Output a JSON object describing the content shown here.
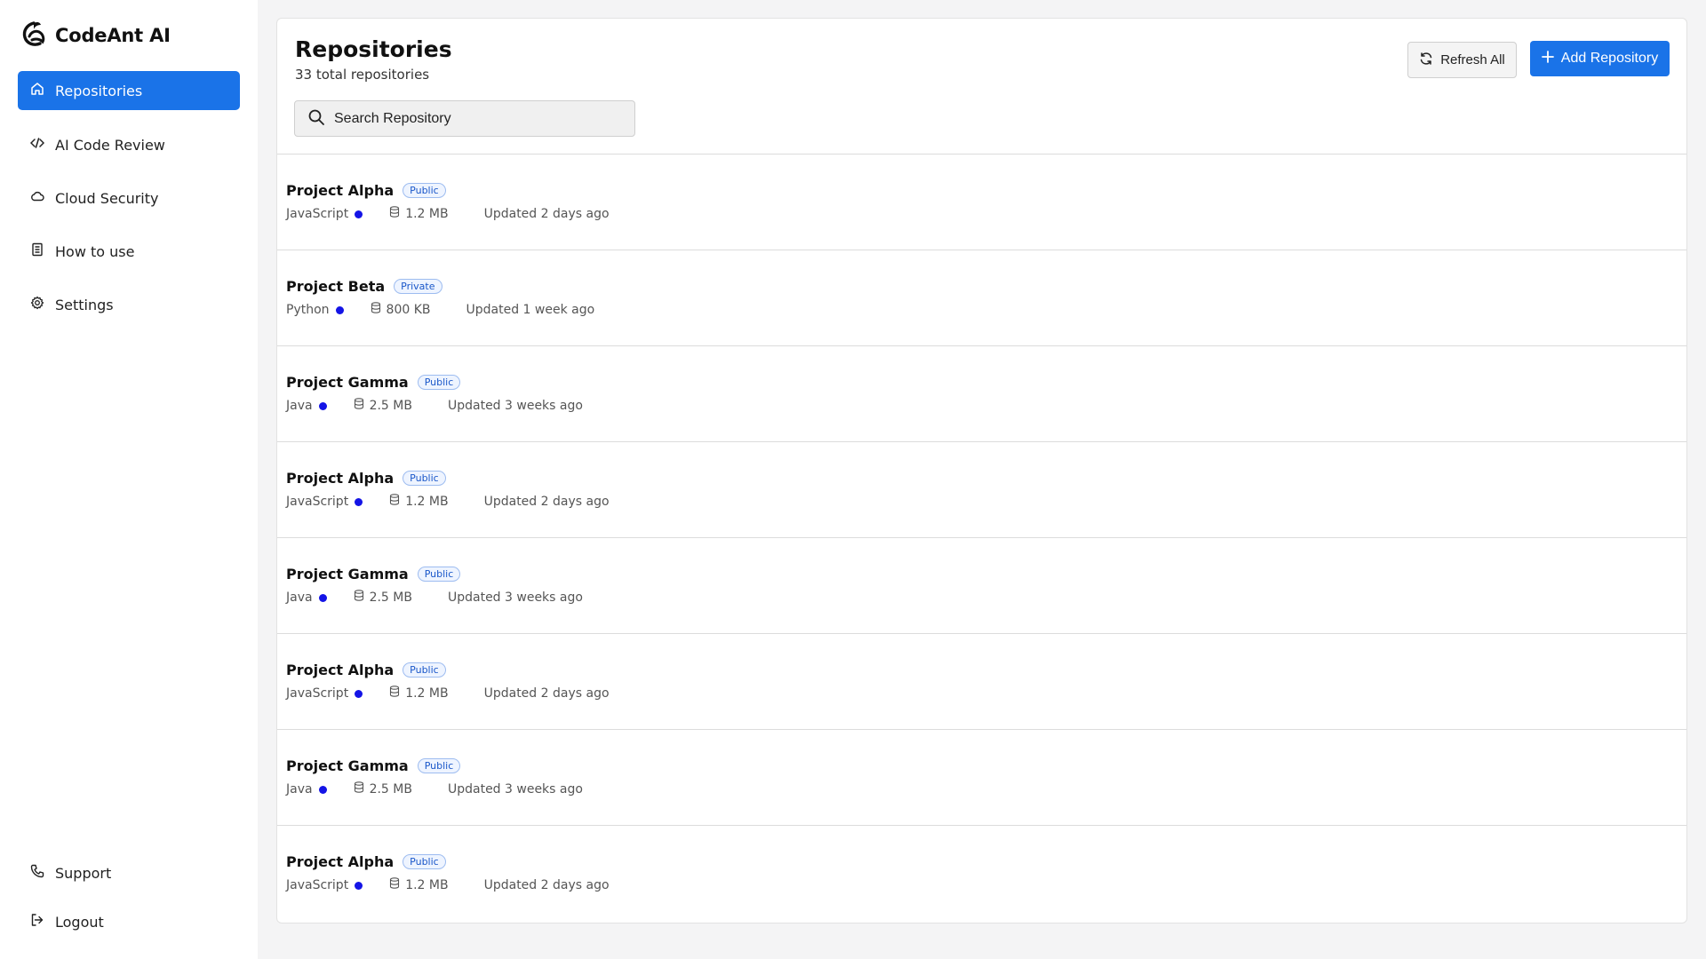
{
  "brand": {
    "name": "CodeAnt AI"
  },
  "sidebar": {
    "items": [
      {
        "label": "Repositories",
        "icon": "home-icon",
        "active": true
      },
      {
        "label": "AI Code Review",
        "icon": "code-icon",
        "active": false
      },
      {
        "label": "Cloud Security",
        "icon": "cloud-icon",
        "active": false
      },
      {
        "label": "How to use",
        "icon": "book-icon",
        "active": false
      },
      {
        "label": "Settings",
        "icon": "gear-icon",
        "active": false
      }
    ],
    "bottom_items": [
      {
        "label": "Support",
        "icon": "phone-icon"
      },
      {
        "label": "Logout",
        "icon": "logout-icon"
      }
    ]
  },
  "header": {
    "title": "Repositories",
    "subtitle": "33 total repositories",
    "refresh_label": "Refresh All",
    "add_label": "Add Repository"
  },
  "search": {
    "placeholder": "Search Repository"
  },
  "repositories": [
    {
      "name": "Project Alpha",
      "visibility": "Public",
      "language": "JavaScript",
      "size": "1.2 MB",
      "updated": "Updated 2 days ago"
    },
    {
      "name": "Project Beta",
      "visibility": "Private",
      "language": "Python",
      "size": "800 KB",
      "updated": "Updated 1 week ago"
    },
    {
      "name": "Project Gamma",
      "visibility": "Public",
      "language": "Java",
      "size": "2.5 MB",
      "updated": "Updated 3 weeks ago"
    },
    {
      "name": "Project Alpha",
      "visibility": "Public",
      "language": "JavaScript",
      "size": "1.2 MB",
      "updated": "Updated 2 days ago"
    },
    {
      "name": "Project Gamma",
      "visibility": "Public",
      "language": "Java",
      "size": "2.5 MB",
      "updated": "Updated 3 weeks ago"
    },
    {
      "name": "Project Alpha",
      "visibility": "Public",
      "language": "JavaScript",
      "size": "1.2 MB",
      "updated": "Updated 2 days ago"
    },
    {
      "name": "Project Gamma",
      "visibility": "Public",
      "language": "Java",
      "size": "2.5 MB",
      "updated": "Updated 3 weeks ago"
    },
    {
      "name": "Project Alpha",
      "visibility": "Public",
      "language": "JavaScript",
      "size": "1.2 MB",
      "updated": "Updated 2 days ago"
    }
  ],
  "colors": {
    "accent": "#1a73e8",
    "language_dot": "#1414e6",
    "badge_text": "#1a57c9"
  }
}
